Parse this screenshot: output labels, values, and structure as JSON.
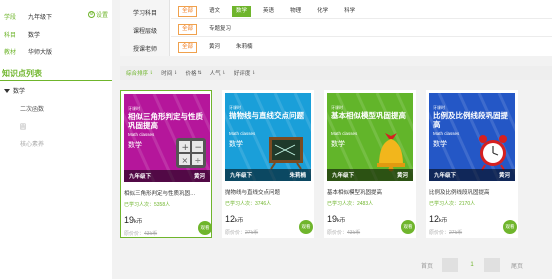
{
  "sidebar": {
    "info": [
      {
        "label": "学段",
        "value": "九年级下"
      },
      {
        "label": "科目",
        "value": "数学"
      },
      {
        "label": "教材",
        "value": "华师大版"
      }
    ],
    "settings_label": "设置",
    "knowledge_title": "知识点列表",
    "tree_root": "数学",
    "tree_items": [
      "二次函数",
      "圆",
      "核心素养"
    ]
  },
  "filters": {
    "rows": [
      {
        "label": "学习科目",
        "options": [
          "全部",
          "语文",
          "数学",
          "英语",
          "物理",
          "化学",
          "科学"
        ],
        "selected": 2
      },
      {
        "label": "课程层级",
        "options": [
          "全部",
          "专题复习"
        ],
        "selected": 0
      },
      {
        "label": "授课老师",
        "options": [
          "全部",
          "黄河",
          "朱莉楠"
        ],
        "selected": 0
      }
    ]
  },
  "sort": {
    "items": [
      "综合排序",
      "时间",
      "价格",
      "人气",
      "好评度"
    ],
    "active": 0
  },
  "cards": [
    {
      "stamp": "牙课时",
      "title": "相似三角形判定与性质巩固提高",
      "english": "Math classes",
      "subject": "数学",
      "grade": "九年级下",
      "teacher": "黄河",
      "name": "相似三角形判定与性质巩固…",
      "learned": "已学习人次：5358人",
      "price": "19",
      "unit": "k币",
      "orig": "原价价：",
      "orig_price": "43k币",
      "watch": "观看",
      "color": "#b5169b",
      "decor": "calc"
    },
    {
      "stamp": "牙课时",
      "title": "抛物线与直线交点问题",
      "english": "Math classes",
      "subject": "数学",
      "grade": "九年级下",
      "teacher": "朱莉楠",
      "name": "抛物线与直线交点问题",
      "learned": "已学习人次：3746人",
      "price": "12",
      "unit": "k币",
      "orig": "原价价：",
      "orig_price": "27k币",
      "watch": "观看",
      "color": "#1a9fd9",
      "decor": "board"
    },
    {
      "stamp": "牙课时",
      "title": "基本相似模型巩固提高",
      "english": "Math classes",
      "subject": "数学",
      "grade": "九年级下",
      "teacher": "黄河",
      "name": "基本相似模型巩固提高",
      "learned": "已学习人次：2483人",
      "price": "19",
      "unit": "k币",
      "orig": "原价价：",
      "orig_price": "43k币",
      "watch": "观看",
      "color": "#62b52a",
      "decor": "bell"
    },
    {
      "stamp": "牙课时",
      "title": "比例及比例线段巩固提高",
      "english": "Math classes",
      "subject": "数学",
      "grade": "九年级下",
      "teacher": "黄河",
      "name": "比例及比例线段巩固提高",
      "learned": "已学习人次：2170人",
      "price": "12",
      "unit": "k币",
      "orig": "原价价：",
      "orig_price": "27k币",
      "watch": "观看",
      "color": "#2457c6",
      "decor": "clock"
    }
  ],
  "pager": {
    "first": "首页",
    "current": "1",
    "last": "尾页"
  }
}
